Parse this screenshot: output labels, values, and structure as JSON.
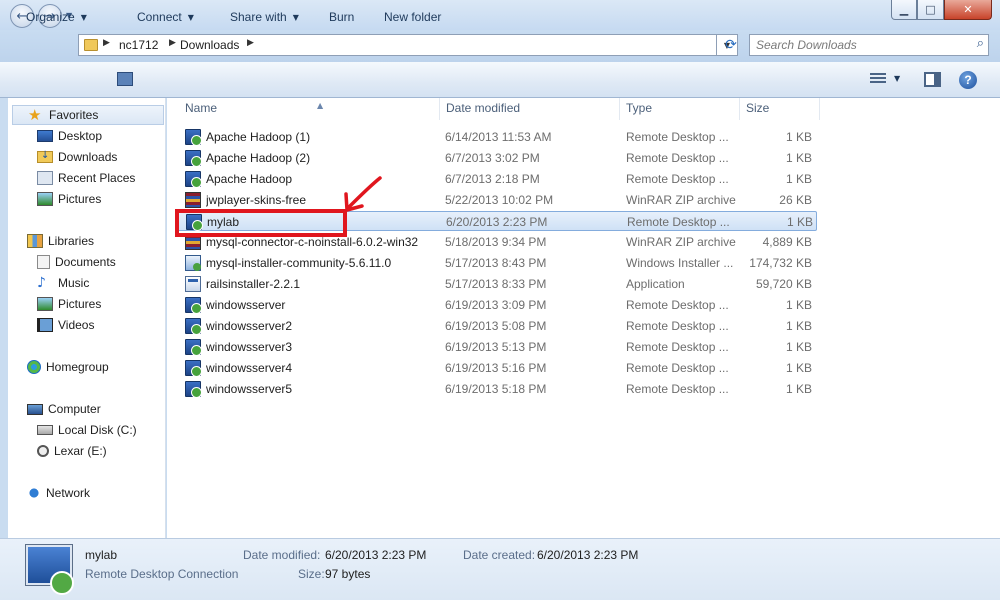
{
  "window": {
    "minimize_glyph": "▁",
    "maximize_glyph": "□",
    "close_glyph": "✕"
  },
  "address": {
    "segments": [
      "nc1712",
      "Downloads"
    ],
    "search_placeholder": "Search Downloads"
  },
  "toolbar": {
    "organize": "Organize",
    "connect": "Connect",
    "share_with": "Share with",
    "burn": "Burn",
    "new_folder": "New folder",
    "help": "?"
  },
  "nav": {
    "favorites": "Favorites",
    "desktop": "Desktop",
    "downloads": "Downloads",
    "recent_places": "Recent Places",
    "pictures_fav": "Pictures",
    "libraries": "Libraries",
    "documents": "Documents",
    "music": "Music",
    "pictures_lib": "Pictures",
    "videos": "Videos",
    "homegroup": "Homegroup",
    "computer": "Computer",
    "local_disk": "Local Disk (C:)",
    "lexar": "Lexar (E:)",
    "network": "Network"
  },
  "columns": {
    "name": "Name",
    "date_modified": "Date modified",
    "type": "Type",
    "size": "Size"
  },
  "files": [
    {
      "name": "Apache Hadoop (1)",
      "date": "6/14/2013 11:53 AM",
      "type": "Remote Desktop ...",
      "size": "1 KB",
      "icon": "rdp-icon"
    },
    {
      "name": "Apache Hadoop (2)",
      "date": "6/7/2013 3:02 PM",
      "type": "Remote Desktop ...",
      "size": "1 KB",
      "icon": "rdp-icon"
    },
    {
      "name": "Apache Hadoop",
      "date": "6/7/2013 2:18 PM",
      "type": "Remote Desktop ...",
      "size": "1 KB",
      "icon": "rdp-icon"
    },
    {
      "name": "jwplayer-skins-free",
      "date": "5/22/2013 10:02 PM",
      "type": "WinRAR ZIP archive",
      "size": "26 KB",
      "icon": "zip-icon"
    },
    {
      "name": "mylab",
      "date": "6/20/2013 2:23 PM",
      "type": "Remote Desktop ...",
      "size": "1 KB",
      "icon": "rdp-icon"
    },
    {
      "name": "mysql-connector-c-noinstall-6.0.2-win32",
      "date": "5/18/2013 9:34 PM",
      "type": "WinRAR ZIP archive",
      "size": "4,889 KB",
      "icon": "zip-icon"
    },
    {
      "name": "mysql-installer-community-5.6.11.0",
      "date": "5/17/2013 8:43 PM",
      "type": "Windows Installer ...",
      "size": "174,732 KB",
      "icon": "installer-icon"
    },
    {
      "name": "railsinstaller-2.2.1",
      "date": "5/17/2013 8:33 PM",
      "type": "Application",
      "size": "59,720 KB",
      "icon": "application-icon"
    },
    {
      "name": "windowsserver",
      "date": "6/19/2013 3:09 PM",
      "type": "Remote Desktop ...",
      "size": "1 KB",
      "icon": "rdp-icon"
    },
    {
      "name": "windowsserver2",
      "date": "6/19/2013 5:08 PM",
      "type": "Remote Desktop ...",
      "size": "1 KB",
      "icon": "rdp-icon"
    },
    {
      "name": "windowsserver3",
      "date": "6/19/2013 5:13 PM",
      "type": "Remote Desktop ...",
      "size": "1 KB",
      "icon": "rdp-icon"
    },
    {
      "name": "windowsserver4",
      "date": "6/19/2013 5:16 PM",
      "type": "Remote Desktop ...",
      "size": "1 KB",
      "icon": "rdp-icon"
    },
    {
      "name": "windowsserver5",
      "date": "6/19/2013 5:18 PM",
      "type": "Remote Desktop ...",
      "size": "1 KB",
      "icon": "rdp-icon"
    }
  ],
  "selected_file_index": 4,
  "details": {
    "name": "mylab",
    "type": "Remote Desktop Connection",
    "date_modified_label": "Date modified:",
    "date_modified": "6/20/2013 2:23 PM",
    "date_created_label": "Date created:",
    "date_created": "6/20/2013 2:23 PM",
    "size_label": "Size:",
    "size": "97 bytes"
  },
  "annotation_color": "#e0161e"
}
